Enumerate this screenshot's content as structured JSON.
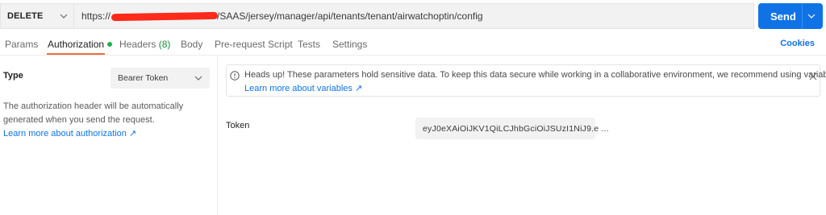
{
  "request": {
    "method": "DELETE",
    "url": "https://[redacted]/SAAS/jersey/manager/api/tenants/tenant/airwatchoptin/config",
    "url_prefix": "https://",
    "url_suffix": "/SAAS/jersey/manager/api/tenants/tenant/airwatchoptin/config",
    "send_label": "Send"
  },
  "tabs": [
    {
      "label": "Params"
    },
    {
      "label": "Authorization",
      "active": true
    },
    {
      "label": "Headers",
      "count": "(8)"
    },
    {
      "label": "Body"
    },
    {
      "label": "Pre-request Script"
    },
    {
      "label": "Tests"
    },
    {
      "label": "Settings"
    }
  ],
  "cookies_label": "Cookies",
  "auth": {
    "type_label": "Type",
    "type_value": "Bearer Token",
    "description": "The authorization header will be automatically generated when you send the request.",
    "learn_more": "Learn more about authorization ↗"
  },
  "notice": {
    "text": "Heads up! These parameters hold sensitive data. To keep this data secure while working in a collaborative environment, we recommend using variables.",
    "link": "Learn more about variables ↗"
  },
  "token": {
    "label": "Token",
    "value": "eyJ0eXAiOiJKV1QiLCJhbGciOiJSUzI1NiJ9.e ..."
  },
  "colors": {
    "accent": "#0f73e6",
    "active_tab_underline": "#f26b3a",
    "status_dot": "#23b04a"
  },
  "icons": [
    "chevron-down-icon",
    "info-icon",
    "close-icon",
    "external-link-icon"
  ]
}
